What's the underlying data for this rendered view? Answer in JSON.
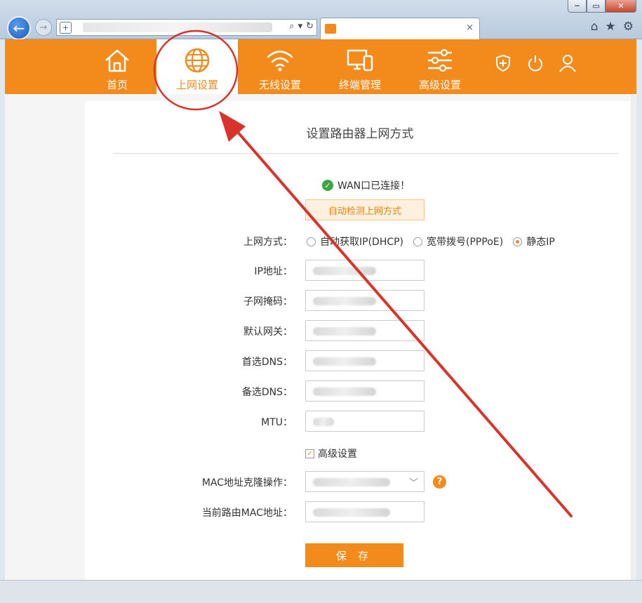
{
  "browser": {
    "tab_close": "×",
    "window_min": "─",
    "window_max": "▭",
    "window_close": "✕"
  },
  "nav": {
    "items": [
      {
        "label": "首页"
      },
      {
        "label": "上网设置"
      },
      {
        "label": "无线设置"
      },
      {
        "label": "终端管理"
      },
      {
        "label": "高级设置"
      }
    ],
    "active_index": 1
  },
  "main": {
    "title": "设置路由器上网方式",
    "wan_status": "WAN口已连接！",
    "detect_button": "自动检测上网方式",
    "mode_label": "上网方式：",
    "modes": [
      "自动获取IP(DHCP)",
      "宽带拨号(PPPoE)",
      "静态IP"
    ],
    "selected_mode": "静态IP",
    "fields": [
      {
        "label": "IP地址："
      },
      {
        "label": "子网掩码："
      },
      {
        "label": "默认网关："
      },
      {
        "label": "首选DNS："
      },
      {
        "label": "备选DNS："
      },
      {
        "label": "MTU："
      }
    ],
    "advanced_label": "高级设置",
    "mac_clone_label": "MAC地址克隆操作：",
    "current_mac_label": "当前路由MAC地址：",
    "save_button": "保 存"
  },
  "colors": {
    "brand": "#f28a1c",
    "annotation": "#d9342b",
    "ok": "#3aa742"
  }
}
